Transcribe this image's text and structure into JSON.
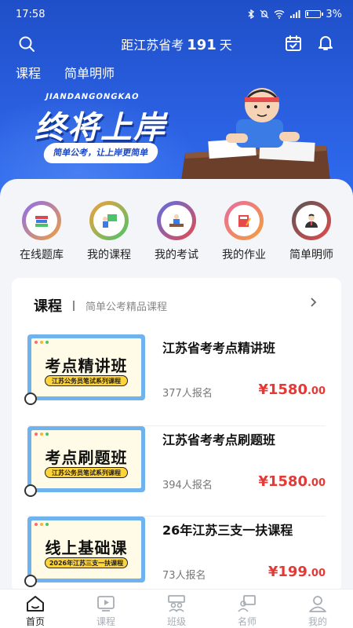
{
  "status_bar": {
    "time": "17:58",
    "battery": "3%"
  },
  "header": {
    "countdown_prefix": "距江苏省考",
    "countdown_days": "191",
    "countdown_suffix": "天"
  },
  "top_tabs": [
    "课程",
    "简单明师"
  ],
  "hero": {
    "english": "JIANDANGONGKAO",
    "title": "终将上岸",
    "slogan": "简单公考，让上岸更简单"
  },
  "quick_links": [
    {
      "label": "在线题库",
      "color": "#8a6cf0"
    },
    {
      "label": "我的课程",
      "color": "#f2a03d"
    },
    {
      "label": "我的考试",
      "color": "#5b6ee8"
    },
    {
      "label": "我的作业",
      "color": "#e86aa0"
    },
    {
      "label": "简单明师",
      "color": "#555555"
    }
  ],
  "course_card": {
    "title": "课程",
    "subtitle": "简单公考精品课程",
    "courses": [
      {
        "thumb_title": "考点精讲班",
        "thumb_ribbon": "江苏公务员笔试系列课程",
        "name": "江苏省考考点精讲班",
        "enrolled": "377人报名",
        "price": "¥1580",
        "price_decimal": ".00"
      },
      {
        "thumb_title": "考点刷题班",
        "thumb_ribbon": "江苏公务员笔试系列课程",
        "name": "江苏省考考点刷题班",
        "enrolled": "394人报名",
        "price": "¥1580",
        "price_decimal": ".00"
      },
      {
        "thumb_title": "线上基础课",
        "thumb_ribbon": "2026年江苏三支一扶课程",
        "name": "26年江苏三支一扶课程",
        "enrolled": "73人报名",
        "price": "¥199",
        "price_decimal": ".00"
      }
    ]
  },
  "tab_bar": [
    {
      "label": "首页",
      "active": true
    },
    {
      "label": "课程",
      "active": false
    },
    {
      "label": "班级",
      "active": false
    },
    {
      "label": "名师",
      "active": false
    },
    {
      "label": "我的",
      "active": false
    }
  ]
}
